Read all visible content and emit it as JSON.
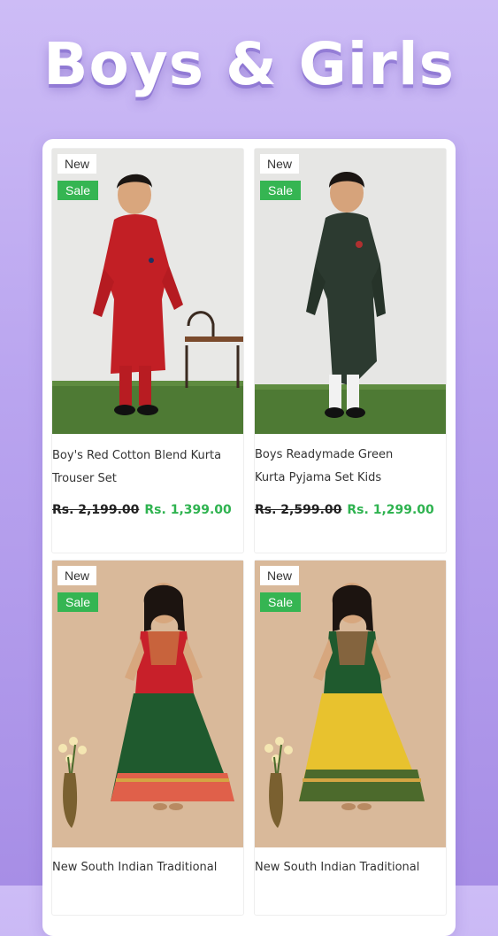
{
  "hero": {
    "title": "Boys & Girls"
  },
  "products": [
    {
      "badge_new": "New",
      "badge_sale": "Sale",
      "name_line1": "Boy's Red Cotton Blend Kurta",
      "name_line2": "Trouser Set",
      "price_old": "Rs. 2,199.00",
      "price_new": "Rs. 1,399.00"
    },
    {
      "badge_new": "New",
      "badge_sale": "Sale",
      "name_line1": "Boys Readymade Green",
      "name_line2": "Kurta Pyjama Set Kids",
      "price_old": "Rs. 2,599.00",
      "price_new": "Rs. 1,299.00"
    },
    {
      "badge_new": "New",
      "badge_sale": "Sale",
      "name_line1": "New South Indian Traditional"
    },
    {
      "badge_new": "New",
      "badge_sale": "Sale",
      "name_line1": "New South Indian Traditional"
    }
  ],
  "colors": {
    "background": "#b9a4ef",
    "sale_badge": "#35b552",
    "sale_price": "#2fb350"
  }
}
